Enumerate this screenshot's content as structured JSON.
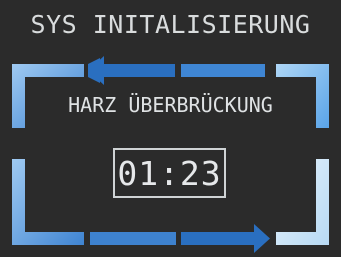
{
  "header": {
    "title": "SYS INITALISIERUNG"
  },
  "status": {
    "label": "HARZ ÜBERBRÜCKUNG",
    "timer": "01:23"
  },
  "colors": {
    "background": "#2b2b2b",
    "segment_light": "#8fc3ef",
    "segment_mid": "#4a90d9",
    "segment_dark": "#2a6fc0",
    "text": "#dfe2e4"
  },
  "icons": {
    "top_arrow": "arrow-left-icon",
    "bottom_arrow": "arrow-right-icon"
  }
}
